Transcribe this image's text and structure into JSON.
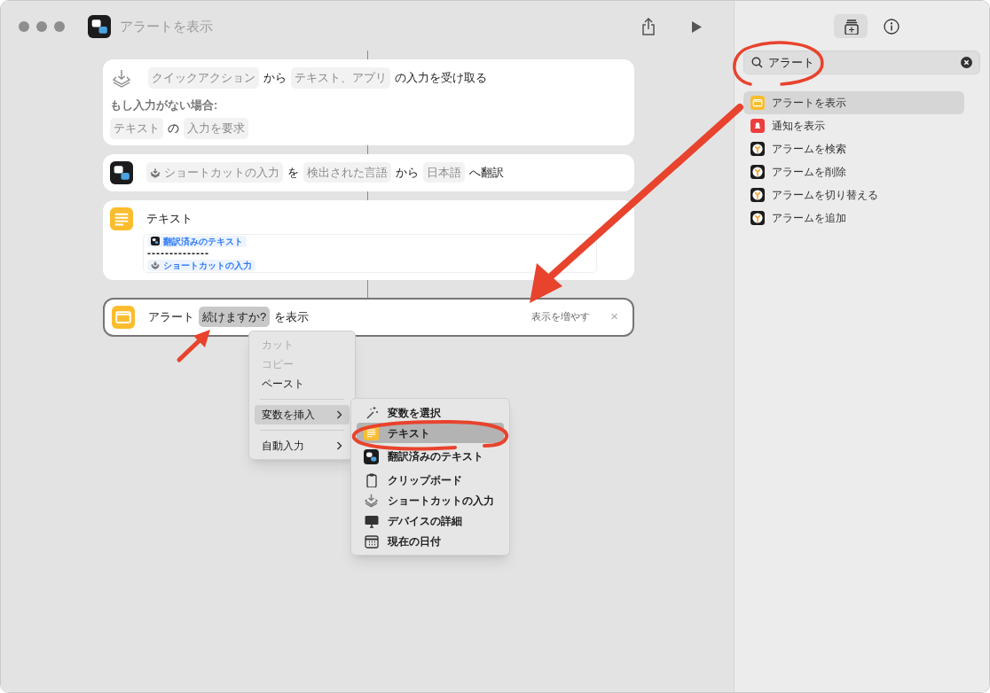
{
  "window": {
    "title": "アラートを表示"
  },
  "actions": [
    {
      "kind": "receive",
      "parts": [
        {
          "text": "クイックアクション",
          "kind": "token"
        },
        {
          "text": "から",
          "kind": "text"
        },
        {
          "text": "テキスト、アプリ",
          "kind": "token"
        },
        {
          "text": "の入力を受け取る",
          "kind": "text"
        }
      ],
      "subtitle": "もし入力がない場合:",
      "parts2": [
        {
          "text": "テキスト",
          "kind": "token"
        },
        {
          "text": "の",
          "kind": "text"
        },
        {
          "text": "入力を要求",
          "kind": "token"
        }
      ]
    },
    {
      "kind": "translate",
      "parts": [
        {
          "text": "ショートカットの入力",
          "kind": "input_token"
        },
        {
          "text": "を",
          "kind": "text"
        },
        {
          "text": "検出された言語",
          "kind": "token"
        },
        {
          "text": "から",
          "kind": "text"
        },
        {
          "text": "日本語",
          "kind": "token"
        },
        {
          "text": "へ翻訳",
          "kind": "text"
        }
      ]
    },
    {
      "kind": "text",
      "title": "テキスト",
      "body": [
        {
          "kind": "translated_variable",
          "text": "翻訳済みのテキスト"
        },
        {
          "kind": "plain",
          "text": "--------------"
        },
        {
          "kind": "input_variable",
          "text": "ショートカットの入力"
        }
      ]
    },
    {
      "kind": "alert",
      "selected": true,
      "parts": [
        {
          "text": "アラート",
          "kind": "text"
        },
        {
          "text": "続けますか?",
          "kind": "token",
          "selected": true
        },
        {
          "text": "を表示",
          "kind": "text"
        }
      ],
      "more": "表示を増やす",
      "close": "×"
    }
  ],
  "context_menu": {
    "items": [
      {
        "label": "カット",
        "disabled": true,
        "submenu": false,
        "selected": false
      },
      {
        "label": "コピー",
        "disabled": true,
        "submenu": false,
        "selected": false
      },
      {
        "label": "ペースト",
        "disabled": false,
        "submenu": false,
        "selected": false
      },
      {
        "label": "変数を挿入",
        "disabled": false,
        "submenu": true,
        "selected": true
      },
      {
        "label": "自動入力",
        "disabled": false,
        "submenu": true,
        "selected": false
      }
    ]
  },
  "submenu": {
    "items": [
      {
        "label": "変数を選択",
        "kind": "wand",
        "selected": false
      },
      {
        "label": "テキスト",
        "kind": "text",
        "selected": true
      },
      {
        "label": "翻訳済みのテキスト",
        "kind": "translate",
        "selected": false
      },
      {
        "label": "クリップボード",
        "kind": "clipboard",
        "selected": false
      },
      {
        "label": "ショートカットの入力",
        "kind": "shortcut",
        "selected": false
      },
      {
        "label": "デバイスの詳細",
        "kind": "device",
        "selected": false
      },
      {
        "label": "現在の日付",
        "kind": "calendar",
        "selected": false
      }
    ]
  },
  "sidebar": {
    "tabs": [
      {
        "kind": "library",
        "selected": true
      },
      {
        "kind": "info",
        "selected": false
      }
    ],
    "search": {
      "value": "アラート"
    },
    "results": [
      {
        "label": "アラートを表示",
        "kind": "alert",
        "selected": true
      },
      {
        "label": "通知を表示",
        "kind": "notify",
        "selected": false
      },
      {
        "label": "アラームを検索",
        "kind": "clock",
        "selected": false
      },
      {
        "label": "アラームを削除",
        "kind": "clock",
        "selected": false
      },
      {
        "label": "アラームを切り替える",
        "kind": "clock",
        "selected": false
      },
      {
        "label": "アラームを追加",
        "kind": "clock",
        "selected": false
      }
    ]
  }
}
